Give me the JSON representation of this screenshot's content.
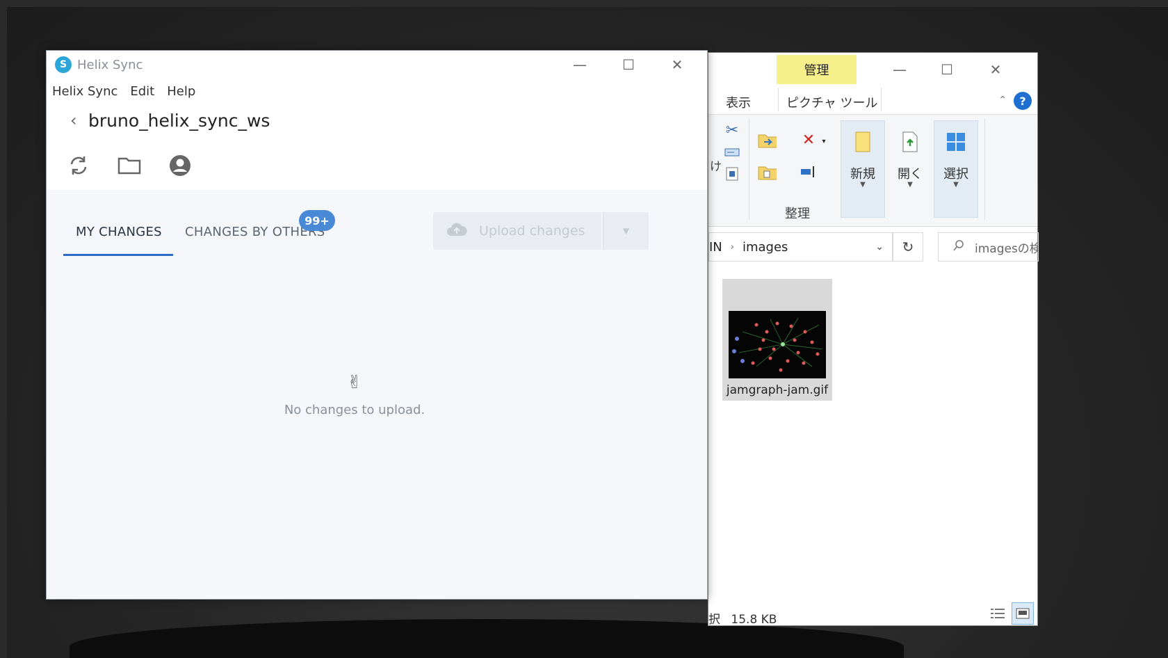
{
  "explorer": {
    "context_tab": "管理",
    "ribbon_tabs": [
      "表示",
      "ピクチャ ツール"
    ],
    "ribbon_partial_label": "け",
    "ribbon_buttons": {
      "new": "新規",
      "open": "開く",
      "select": "選択"
    },
    "ribbon_group": "整理",
    "address": {
      "parent_fragment": "IN",
      "current": "images"
    },
    "search_placeholder": "imagesの検索",
    "file": {
      "name": "jamgraph-jam.gif"
    },
    "status": {
      "prefix": "択",
      "size": "15.8 KB"
    },
    "window_controls": [
      "—",
      "☐",
      "✕"
    ]
  },
  "helix": {
    "title": "Helix Sync",
    "logo_glyph": "S",
    "menu": [
      "Helix Sync",
      "Edit",
      "Help"
    ],
    "workspace": "bruno_helix_sync_ws",
    "tabs": {
      "my_changes": "MY CHANGES",
      "others": "CHANGES BY OTHERS",
      "others_badge": "99+"
    },
    "upload_button": "Upload changes",
    "empty_message": "No changes to upload.",
    "icons": {
      "sync": "sync-icon",
      "folder": "folder-icon",
      "account": "account-icon",
      "empty": "peace-hand-icon",
      "cloud": "cloud-upload-icon"
    }
  },
  "colors": {
    "accent": "#2d6cc4",
    "badge": "#4a89d6",
    "manage_tab": "#f7f08a",
    "helix_logo": "#2aa6d8"
  }
}
